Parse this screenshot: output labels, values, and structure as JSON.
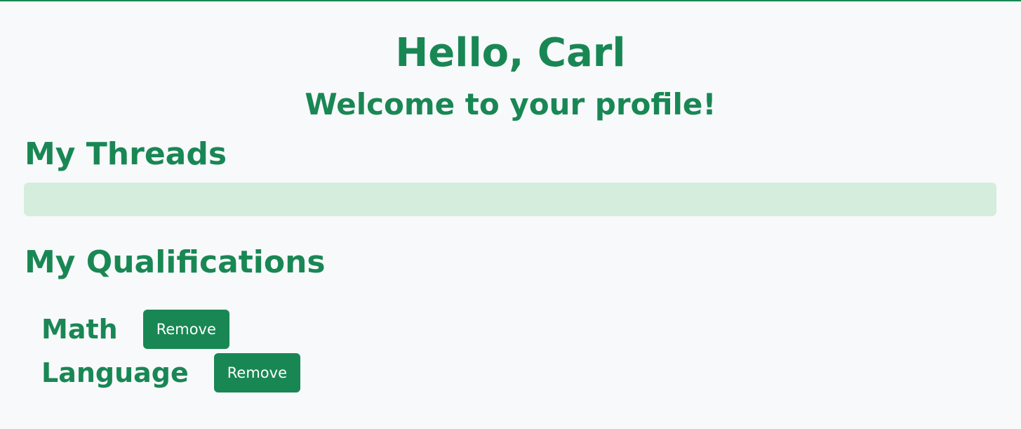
{
  "header": {
    "greeting": "Hello, Carl",
    "welcome": "Welcome to your profile!"
  },
  "threads": {
    "title": "My Threads",
    "items": []
  },
  "qualifications": {
    "title": "My Qualifications",
    "items": [
      {
        "name": "Math",
        "remove_label": "Remove"
      },
      {
        "name": "Language",
        "remove_label": "Remove"
      }
    ]
  },
  "theme": {
    "accent": "#198754",
    "panel_bg": "#d4eddc",
    "page_bg": "#f8f9fb"
  }
}
